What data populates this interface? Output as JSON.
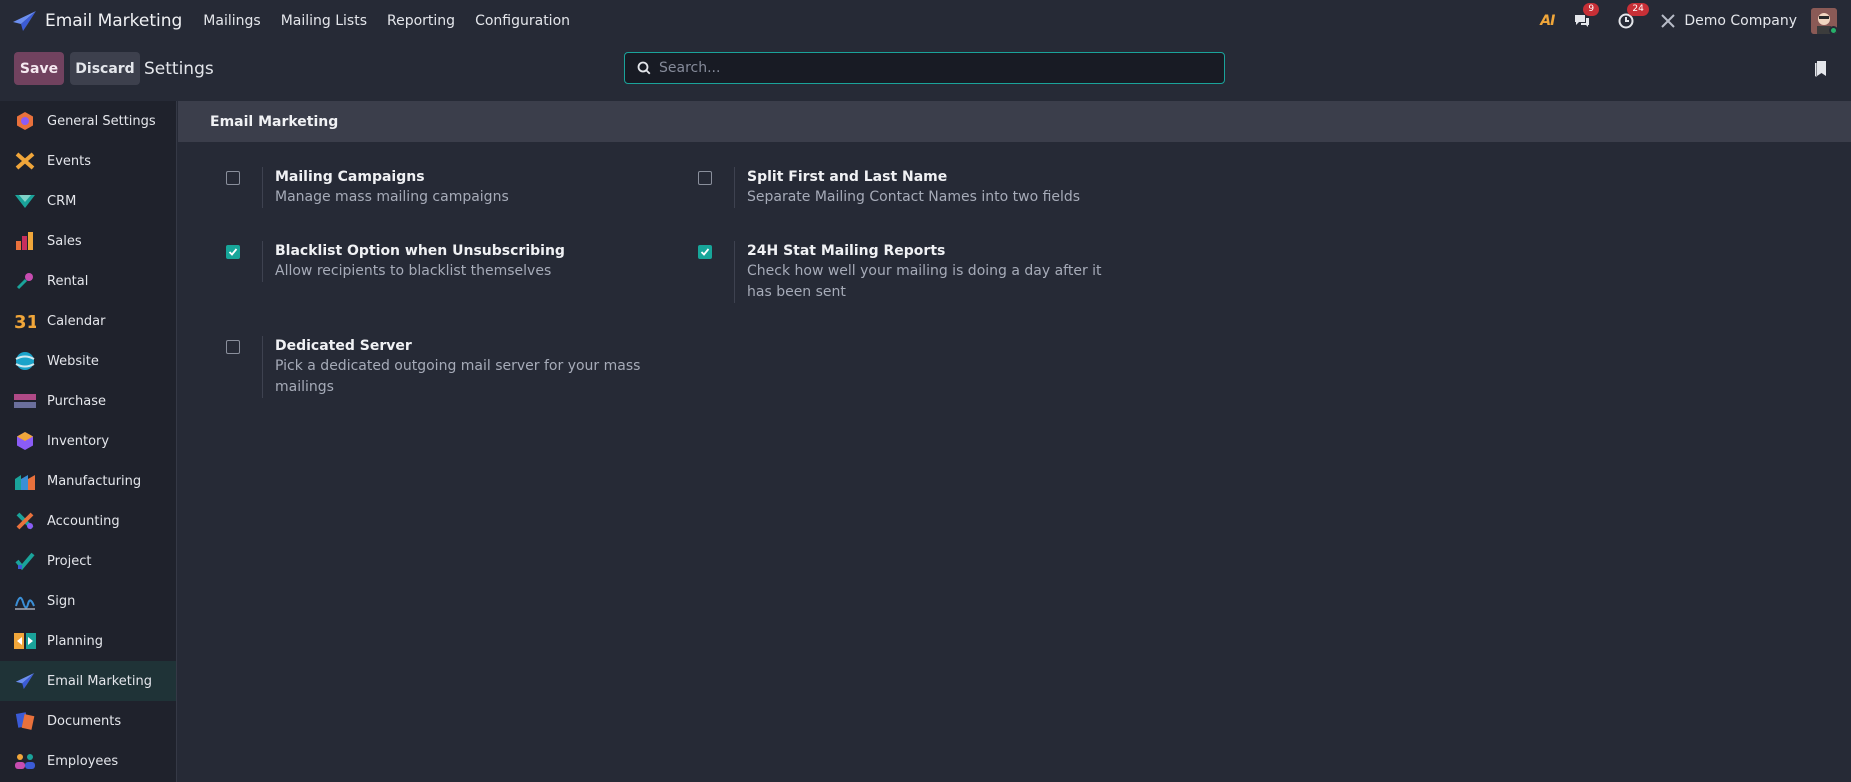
{
  "app": {
    "name": "Email Marketing"
  },
  "menu": [
    "Mailings",
    "Mailing Lists",
    "Reporting",
    "Configuration"
  ],
  "systray": {
    "ai_label": "AI",
    "messages_count": "9",
    "activities_count": "24",
    "company": "Demo Company"
  },
  "control": {
    "save_label": "Save",
    "discard_label": "Discard",
    "title": "Settings",
    "search_placeholder": "Search...",
    "search_value": ""
  },
  "sidebar": {
    "items": [
      {
        "label": "General Settings",
        "icon": "general-settings-icon"
      },
      {
        "label": "Events",
        "icon": "events-icon"
      },
      {
        "label": "CRM",
        "icon": "crm-icon"
      },
      {
        "label": "Sales",
        "icon": "sales-icon"
      },
      {
        "label": "Rental",
        "icon": "rental-icon"
      },
      {
        "label": "Calendar",
        "icon": "calendar-icon"
      },
      {
        "label": "Website",
        "icon": "website-icon"
      },
      {
        "label": "Purchase",
        "icon": "purchase-icon"
      },
      {
        "label": "Inventory",
        "icon": "inventory-icon"
      },
      {
        "label": "Manufacturing",
        "icon": "manufacturing-icon"
      },
      {
        "label": "Accounting",
        "icon": "accounting-icon"
      },
      {
        "label": "Project",
        "icon": "project-icon"
      },
      {
        "label": "Sign",
        "icon": "sign-icon"
      },
      {
        "label": "Planning",
        "icon": "planning-icon"
      },
      {
        "label": "Email Marketing",
        "icon": "email-marketing-icon",
        "active": true
      },
      {
        "label": "Documents",
        "icon": "documents-icon"
      },
      {
        "label": "Employees",
        "icon": "employees-icon"
      }
    ]
  },
  "section": {
    "title": "Email Marketing"
  },
  "settings": [
    {
      "title": "Mailing Campaigns",
      "desc": "Manage mass mailing campaigns",
      "checked": false
    },
    {
      "title": "Split First and Last Name",
      "desc": "Separate Mailing Contact Names into two fields",
      "checked": false
    },
    {
      "title": "Blacklist Option when Unsubscribing",
      "desc": "Allow recipients to blacklist themselves",
      "checked": true
    },
    {
      "title": "24H Stat Mailing Reports",
      "desc": "Check how well your mailing is doing a day after it has been sent",
      "checked": true
    },
    {
      "title": "Dedicated Server",
      "desc": "Pick a dedicated outgoing mail server for your mass mailings",
      "checked": false
    }
  ],
  "colors": {
    "accent": "#17a69a",
    "primary": "#71425f",
    "background": "#262a36",
    "sidebar": "#1f222c"
  }
}
